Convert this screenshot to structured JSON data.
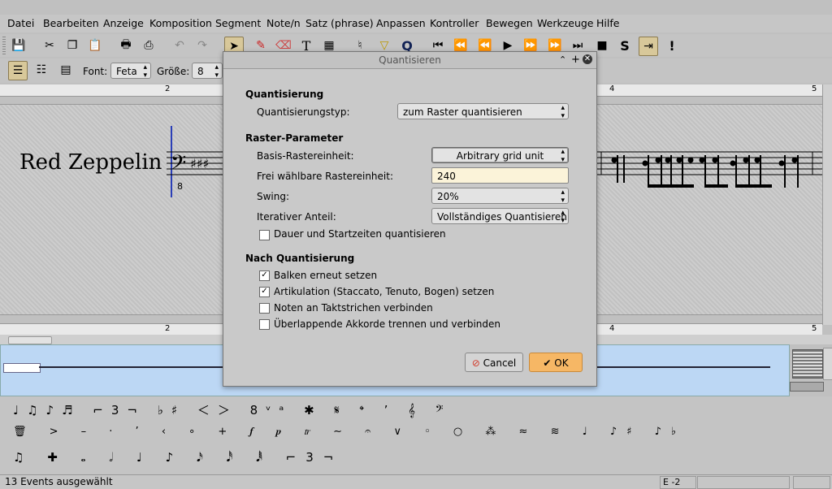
{
  "menubar": {
    "items": [
      "Datei",
      "Bearbeiten",
      "Anzeige",
      "Komposition",
      "Segment",
      "Note/n",
      "Satz (phrase)",
      "Anpassen",
      "Kontroller",
      "Bewegen",
      "Werkzeuge",
      "Hilfe"
    ]
  },
  "toolbar2": {
    "font_label": "Font:",
    "font_value": "Feta",
    "size_label": "Größe:",
    "size_value": "8"
  },
  "score": {
    "title": "Red Zeppelin",
    "measures": [
      "2",
      "4",
      "5"
    ],
    "clef_octave": "8"
  },
  "dialog": {
    "title": "Quantisieren",
    "section_quant": "Quantisierung",
    "quant_type_label": "Quantisierungstyp:",
    "quant_type_value": "zum Raster quantisieren",
    "section_grid": "Raster-Parameter",
    "base_unit_label": "Basis-Rastereinheit:",
    "base_unit_value": "Arbitrary grid unit",
    "free_unit_label": "Frei wählbare Rastereinheit:",
    "free_unit_value": "240",
    "swing_label": "Swing:",
    "swing_value": "20%",
    "iter_label": "Iterativer Anteil:",
    "iter_value": "Vollständiges Quantisieren",
    "dur_start_label": "Dauer und Startzeiten quantisieren",
    "dur_start_checked": false,
    "section_after": "Nach Quantisierung",
    "after_options": [
      {
        "label": "Balken erneut setzen",
        "checked": true
      },
      {
        "label": "Artikulation (Staccato, Tenuto, Bogen) setzen",
        "checked": true
      },
      {
        "label": "Noten an Taktstrichen verbinden",
        "checked": false
      },
      {
        "label": "Überlappende Akkorde trennen und verbinden",
        "checked": false
      }
    ],
    "cancel_label": "Cancel",
    "ok_label": "OK"
  },
  "status": {
    "events": "13 Events ausgewählt",
    "pos": "E -2"
  },
  "colors": {
    "ok": "#f6b765",
    "cancel_icon": "#d23a2a",
    "panel": "#bcd7f4",
    "field": "#fbf3d9"
  }
}
